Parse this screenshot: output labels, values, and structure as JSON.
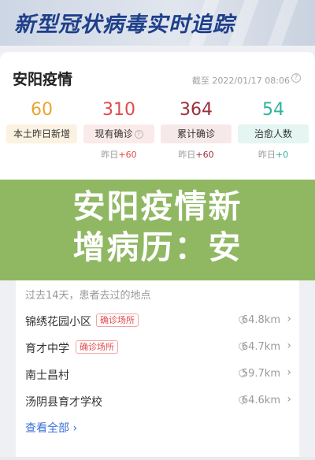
{
  "banner": {
    "title": "新型冠状病毒实时追踪"
  },
  "card": {
    "title": "安阳疫情",
    "timestamp": "截至 2022/01/17 08:06",
    "stats": [
      {
        "value": "60",
        "label": "本土昨日新增",
        "delta_prefix": "",
        "delta_value": "",
        "color": "#e8a531",
        "bg": "#fbf2e1"
      },
      {
        "value": "310",
        "label": "现有确诊",
        "delta_prefix": "昨日",
        "delta_value": "+60",
        "color": "#e24a4a",
        "bg": "#fbeaea"
      },
      {
        "value": "364",
        "label": "累计确诊",
        "delta_prefix": "昨日",
        "delta_value": "+60",
        "color": "#9c2f3a",
        "bg": "#f7e8ea"
      },
      {
        "value": "54",
        "label": "治愈人数",
        "delta_prefix": "昨日",
        "delta_value": "+0",
        "color": "#2fb29c",
        "bg": "#e4f5f2"
      }
    ]
  },
  "overlay": {
    "line1": "安阳疫情新",
    "line2": "增病历：安"
  },
  "places": {
    "caption": "过去14天，患者去过的地点",
    "items": [
      {
        "name": "锦绣花园小区",
        "tag": "确诊场所",
        "distance": "64.8km"
      },
      {
        "name": "育才中学",
        "tag": "确诊场所",
        "distance": "64.7km"
      },
      {
        "name": "南士昌村",
        "tag": "",
        "distance": "59.7km"
      },
      {
        "name": "汤阴县育才学校",
        "tag": "",
        "distance": "64.6km"
      }
    ],
    "view_all": "查看全部 ›"
  },
  "colors": {
    "link": "#3b6fd6",
    "overlay": "#90b863",
    "banner_text": "#1e3f8a"
  }
}
